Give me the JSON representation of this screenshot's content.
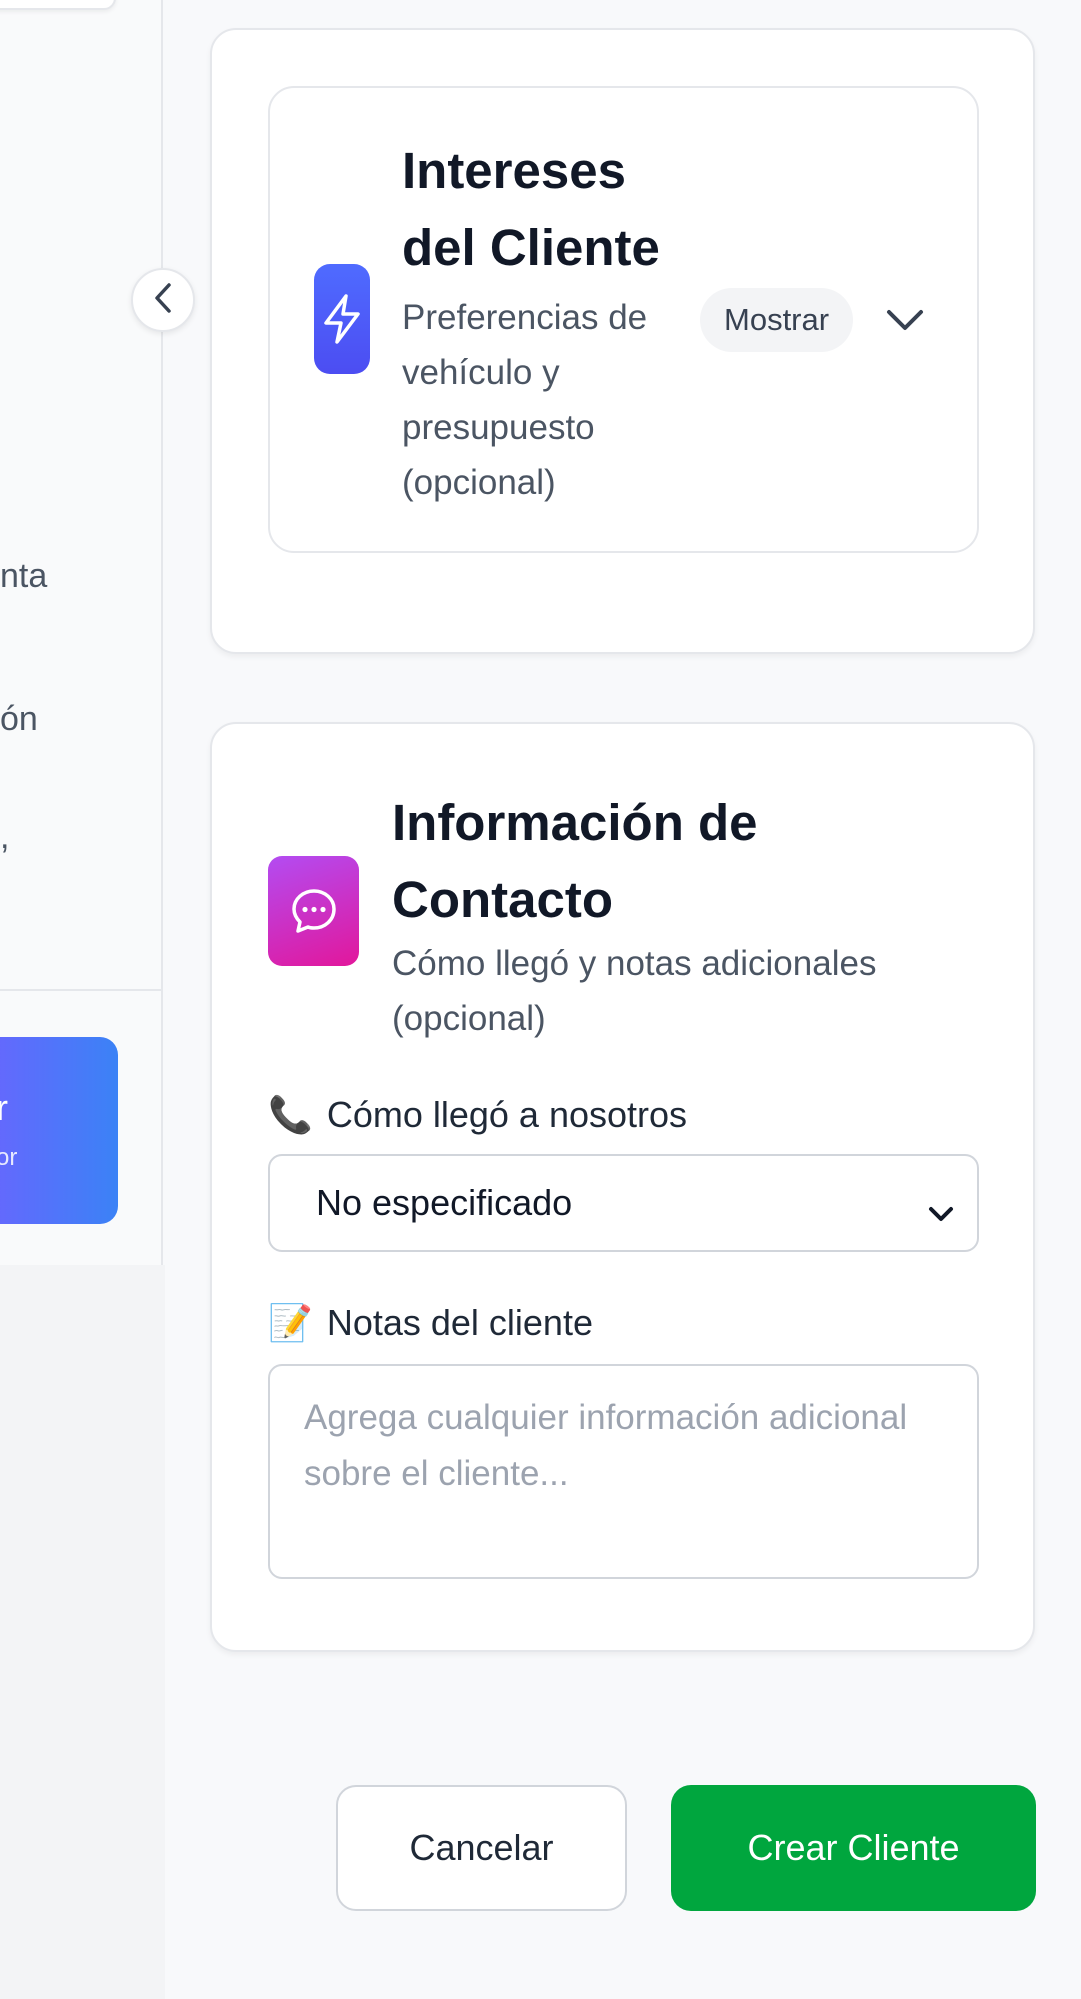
{
  "sidebar": {
    "fragments": [
      "nta",
      "ón",
      ","
    ],
    "promo": {
      "line1": "r",
      "line2": "or"
    }
  },
  "interests": {
    "title": "Intereses del Cliente",
    "subtitle": "Preferencias de vehículo y presupuesto (opcional)",
    "toggle_label": "Mostrar",
    "icon": "bolt-icon"
  },
  "contact": {
    "title": "Información de Contacto",
    "subtitle": "Cómo llegó y notas adicionales (opcional)",
    "icon": "chat-bubble-icon",
    "source_field": {
      "label": "Cómo llegó a nosotros",
      "emoji": "📞",
      "value": "No especificado"
    },
    "notes_field": {
      "label": "Notas del cliente",
      "emoji": "📝",
      "placeholder": "Agrega cualquier información adicional sobre el cliente..."
    }
  },
  "actions": {
    "cancel_label": "Cancelar",
    "create_label": "Crear Cliente"
  },
  "colors": {
    "accent_green": "#00a63e",
    "bolt_tile": "#4c4df2",
    "chat_tile_start": "#b34cf2",
    "chat_tile_end": "#e2179b"
  }
}
